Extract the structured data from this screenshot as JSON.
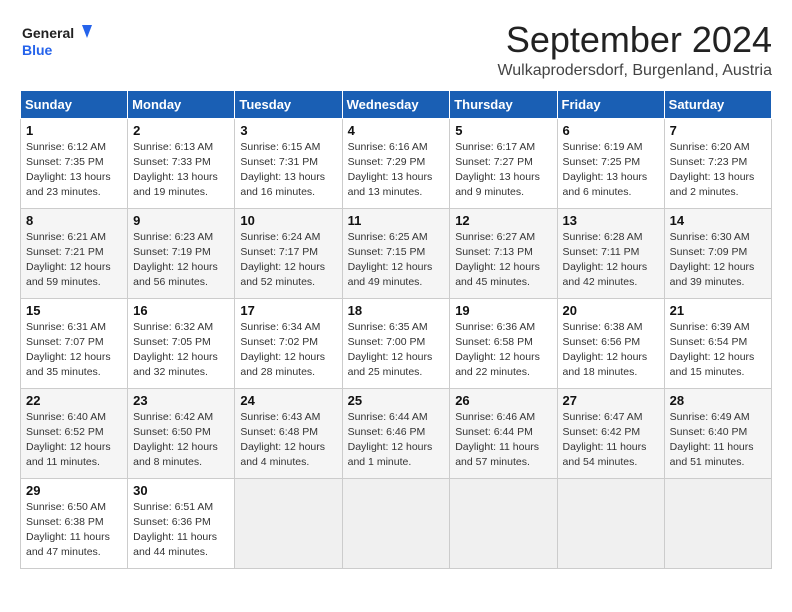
{
  "header": {
    "logo_general": "General",
    "logo_blue": "Blue",
    "month": "September 2024",
    "location": "Wulkaprodersdorf, Burgenland, Austria"
  },
  "weekdays": [
    "Sunday",
    "Monday",
    "Tuesday",
    "Wednesday",
    "Thursday",
    "Friday",
    "Saturday"
  ],
  "weeks": [
    [
      {
        "day": "1",
        "lines": [
          "Sunrise: 6:12 AM",
          "Sunset: 7:35 PM",
          "Daylight: 13 hours",
          "and 23 minutes."
        ]
      },
      {
        "day": "2",
        "lines": [
          "Sunrise: 6:13 AM",
          "Sunset: 7:33 PM",
          "Daylight: 13 hours",
          "and 19 minutes."
        ]
      },
      {
        "day": "3",
        "lines": [
          "Sunrise: 6:15 AM",
          "Sunset: 7:31 PM",
          "Daylight: 13 hours",
          "and 16 minutes."
        ]
      },
      {
        "day": "4",
        "lines": [
          "Sunrise: 6:16 AM",
          "Sunset: 7:29 PM",
          "Daylight: 13 hours",
          "and 13 minutes."
        ]
      },
      {
        "day": "5",
        "lines": [
          "Sunrise: 6:17 AM",
          "Sunset: 7:27 PM",
          "Daylight: 13 hours",
          "and 9 minutes."
        ]
      },
      {
        "day": "6",
        "lines": [
          "Sunrise: 6:19 AM",
          "Sunset: 7:25 PM",
          "Daylight: 13 hours",
          "and 6 minutes."
        ]
      },
      {
        "day": "7",
        "lines": [
          "Sunrise: 6:20 AM",
          "Sunset: 7:23 PM",
          "Daylight: 13 hours",
          "and 2 minutes."
        ]
      }
    ],
    [
      {
        "day": "8",
        "lines": [
          "Sunrise: 6:21 AM",
          "Sunset: 7:21 PM",
          "Daylight: 12 hours",
          "and 59 minutes."
        ]
      },
      {
        "day": "9",
        "lines": [
          "Sunrise: 6:23 AM",
          "Sunset: 7:19 PM",
          "Daylight: 12 hours",
          "and 56 minutes."
        ]
      },
      {
        "day": "10",
        "lines": [
          "Sunrise: 6:24 AM",
          "Sunset: 7:17 PM",
          "Daylight: 12 hours",
          "and 52 minutes."
        ]
      },
      {
        "day": "11",
        "lines": [
          "Sunrise: 6:25 AM",
          "Sunset: 7:15 PM",
          "Daylight: 12 hours",
          "and 49 minutes."
        ]
      },
      {
        "day": "12",
        "lines": [
          "Sunrise: 6:27 AM",
          "Sunset: 7:13 PM",
          "Daylight: 12 hours",
          "and 45 minutes."
        ]
      },
      {
        "day": "13",
        "lines": [
          "Sunrise: 6:28 AM",
          "Sunset: 7:11 PM",
          "Daylight: 12 hours",
          "and 42 minutes."
        ]
      },
      {
        "day": "14",
        "lines": [
          "Sunrise: 6:30 AM",
          "Sunset: 7:09 PM",
          "Daylight: 12 hours",
          "and 39 minutes."
        ]
      }
    ],
    [
      {
        "day": "15",
        "lines": [
          "Sunrise: 6:31 AM",
          "Sunset: 7:07 PM",
          "Daylight: 12 hours",
          "and 35 minutes."
        ]
      },
      {
        "day": "16",
        "lines": [
          "Sunrise: 6:32 AM",
          "Sunset: 7:05 PM",
          "Daylight: 12 hours",
          "and 32 minutes."
        ]
      },
      {
        "day": "17",
        "lines": [
          "Sunrise: 6:34 AM",
          "Sunset: 7:02 PM",
          "Daylight: 12 hours",
          "and 28 minutes."
        ]
      },
      {
        "day": "18",
        "lines": [
          "Sunrise: 6:35 AM",
          "Sunset: 7:00 PM",
          "Daylight: 12 hours",
          "and 25 minutes."
        ]
      },
      {
        "day": "19",
        "lines": [
          "Sunrise: 6:36 AM",
          "Sunset: 6:58 PM",
          "Daylight: 12 hours",
          "and 22 minutes."
        ]
      },
      {
        "day": "20",
        "lines": [
          "Sunrise: 6:38 AM",
          "Sunset: 6:56 PM",
          "Daylight: 12 hours",
          "and 18 minutes."
        ]
      },
      {
        "day": "21",
        "lines": [
          "Sunrise: 6:39 AM",
          "Sunset: 6:54 PM",
          "Daylight: 12 hours",
          "and 15 minutes."
        ]
      }
    ],
    [
      {
        "day": "22",
        "lines": [
          "Sunrise: 6:40 AM",
          "Sunset: 6:52 PM",
          "Daylight: 12 hours",
          "and 11 minutes."
        ]
      },
      {
        "day": "23",
        "lines": [
          "Sunrise: 6:42 AM",
          "Sunset: 6:50 PM",
          "Daylight: 12 hours",
          "and 8 minutes."
        ]
      },
      {
        "day": "24",
        "lines": [
          "Sunrise: 6:43 AM",
          "Sunset: 6:48 PM",
          "Daylight: 12 hours",
          "and 4 minutes."
        ]
      },
      {
        "day": "25",
        "lines": [
          "Sunrise: 6:44 AM",
          "Sunset: 6:46 PM",
          "Daylight: 12 hours",
          "and 1 minute."
        ]
      },
      {
        "day": "26",
        "lines": [
          "Sunrise: 6:46 AM",
          "Sunset: 6:44 PM",
          "Daylight: 11 hours",
          "and 57 minutes."
        ]
      },
      {
        "day": "27",
        "lines": [
          "Sunrise: 6:47 AM",
          "Sunset: 6:42 PM",
          "Daylight: 11 hours",
          "and 54 minutes."
        ]
      },
      {
        "day": "28",
        "lines": [
          "Sunrise: 6:49 AM",
          "Sunset: 6:40 PM",
          "Daylight: 11 hours",
          "and 51 minutes."
        ]
      }
    ],
    [
      {
        "day": "29",
        "lines": [
          "Sunrise: 6:50 AM",
          "Sunset: 6:38 PM",
          "Daylight: 11 hours",
          "and 47 minutes."
        ]
      },
      {
        "day": "30",
        "lines": [
          "Sunrise: 6:51 AM",
          "Sunset: 6:36 PM",
          "Daylight: 11 hours",
          "and 44 minutes."
        ]
      },
      {
        "day": "",
        "lines": []
      },
      {
        "day": "",
        "lines": []
      },
      {
        "day": "",
        "lines": []
      },
      {
        "day": "",
        "lines": []
      },
      {
        "day": "",
        "lines": []
      }
    ]
  ]
}
